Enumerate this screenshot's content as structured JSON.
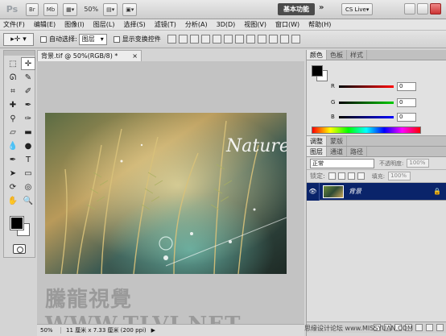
{
  "appbar": {
    "logo": "Ps",
    "br_label": "Br",
    "mb_label": "Mb",
    "zoom": "50%",
    "workspace": "基本功能",
    "overflow": "»",
    "cslive": "CS Live▾"
  },
  "menus": [
    "文件(F)",
    "编辑(E)",
    "图像(I)",
    "图层(L)",
    "选择(S)",
    "滤镜(T)",
    "分析(A)",
    "3D(D)",
    "视图(V)",
    "窗口(W)",
    "帮助(H)"
  ],
  "options": {
    "auto_select_label": "自动选择:",
    "auto_select_value": "图层",
    "show_transform_label": "显示变换控件"
  },
  "document": {
    "tab_title": "背景.tif @ 50%(RGB/8) *",
    "close": "×",
    "image_title": "Nature",
    "zoom": "50%",
    "doc_info": "11 厘米 x 7.33 厘米 (200 ppi)",
    "arrow": "▶",
    "watermark": "騰龍視覺 WWW.TLVI.NET"
  },
  "color_panel": {
    "tabs": [
      "颜色",
      "色板",
      "样式"
    ],
    "r_label": "R",
    "g_label": "G",
    "b_label": "B",
    "r": "0",
    "g": "0",
    "b": "0"
  },
  "adjust_tabs": [
    "调整",
    "蒙版"
  ],
  "layers_panel": {
    "tabs": [
      "图层",
      "通道",
      "路径"
    ],
    "blend_mode": "正常",
    "opacity_label": "不透明度:",
    "opacity": "100%",
    "lock_label": "锁定:",
    "fill_label": "填充:",
    "fill": "100%",
    "layer_name": "背景"
  },
  "credit": "思缘设计论坛 www.MISSYUAN.COM",
  "colors": {
    "selected_layer": "#0a246a",
    "workspace_btn": "#4b4b4b"
  }
}
